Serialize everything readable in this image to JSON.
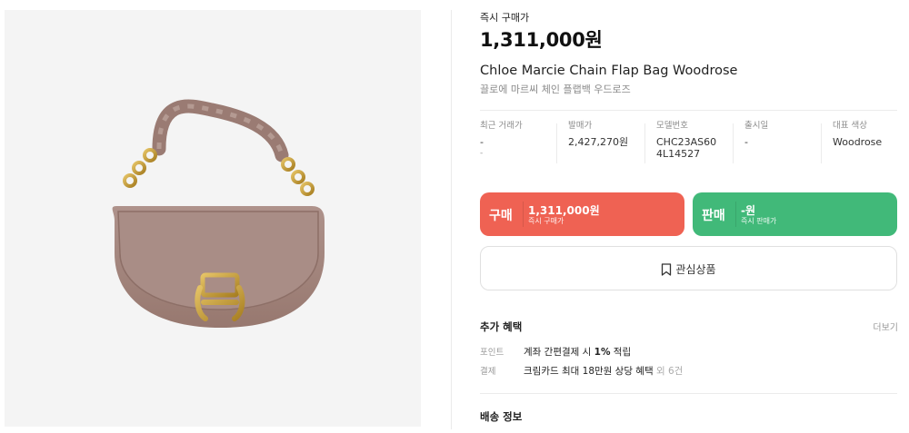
{
  "product": {
    "price_label": "즉시 구매가",
    "price": "1,311,000원",
    "title_en": "Chloe Marcie Chain Flap Bag Woodrose",
    "title_ko": "끌로에 마르씨 체인 플랩백 우드로즈"
  },
  "details": [
    {
      "label": "최근 거래가",
      "value": "-",
      "sub": "-"
    },
    {
      "label": "발매가",
      "value": "2,427,270원"
    },
    {
      "label": "모델번호",
      "value": "CHC23AS60",
      "value2": "4L14527"
    },
    {
      "label": "출시일",
      "value": "-"
    },
    {
      "label": "대표 색상",
      "value": "Woodrose"
    }
  ],
  "buy": {
    "kind": "구매",
    "amount": "1,311,000원",
    "sub": "즉시 구매가"
  },
  "sell": {
    "kind": "판매",
    "amount": "-원",
    "sub": "즉시 판매가"
  },
  "wish": {
    "label": "관심상품",
    "icon": "bookmark-icon"
  },
  "benefits": {
    "title": "추가 혜택",
    "more": "더보기",
    "rows": [
      {
        "category": "포인트",
        "pre": "계좌 간편결제 시 ",
        "bold": "1%",
        "post": " 적립",
        "extra": ""
      },
      {
        "category": "결제",
        "pre": "크림카드 최대 18만원 상당 혜택 ",
        "bold": "",
        "post": "",
        "extra": "외 6건"
      }
    ]
  },
  "shipping": {
    "title": "배송 정보"
  },
  "colors": {
    "buy": "#ef6253",
    "sell": "#41b979",
    "bag": "#a38680",
    "hardware": "#c9a13a"
  }
}
